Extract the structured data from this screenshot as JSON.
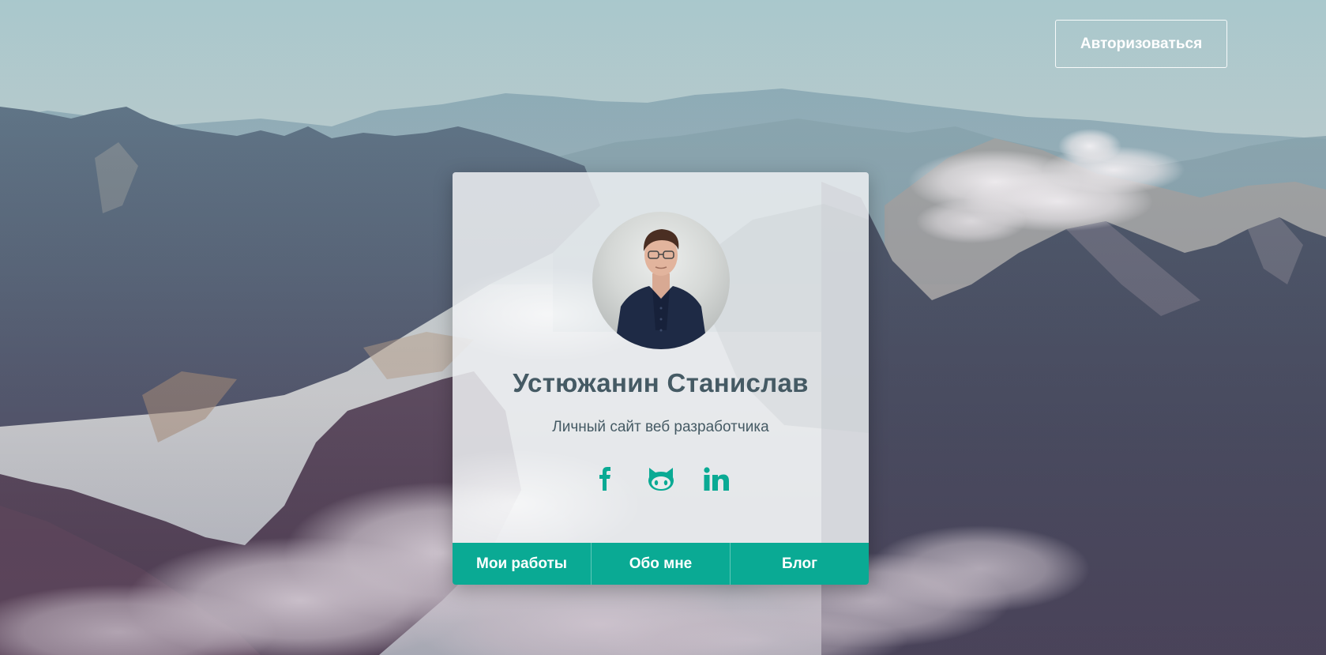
{
  "header": {
    "auth_label": "Авторизоваться"
  },
  "card": {
    "name": "Устюжанин Станислав",
    "subtitle": "Личный сайт веб разработчика",
    "socials": [
      {
        "icon": "facebook-icon"
      },
      {
        "icon": "github-icon"
      },
      {
        "icon": "linkedin-icon"
      }
    ],
    "nav": [
      {
        "label": "Мои работы"
      },
      {
        "label": "Обо мне"
      },
      {
        "label": "Блог"
      }
    ]
  },
  "colors": {
    "accent": "#0aaa94",
    "name_text": "#455a64",
    "card_bg": "#eceff1"
  }
}
